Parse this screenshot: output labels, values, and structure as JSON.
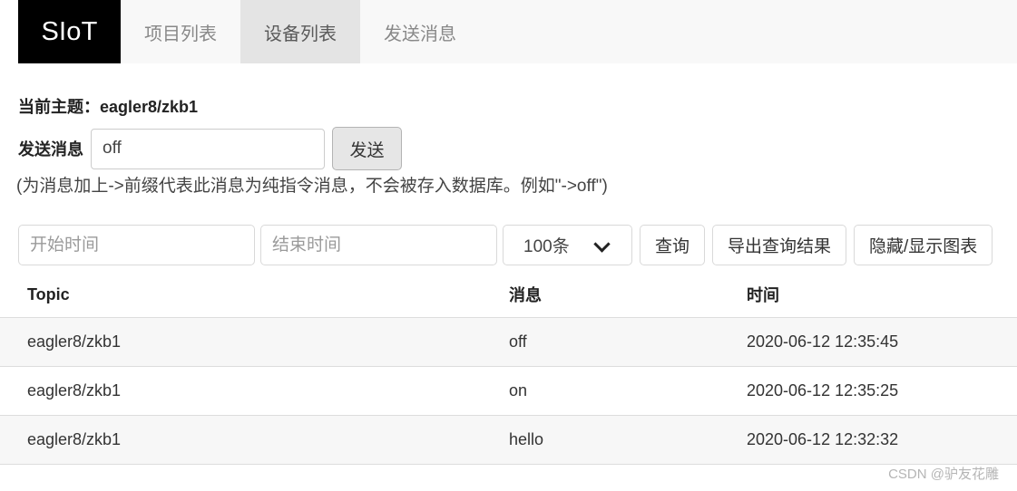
{
  "navbar": {
    "brand": "SIoT",
    "items": [
      {
        "label": "项目列表",
        "active": false
      },
      {
        "label": "设备列表",
        "active": true
      },
      {
        "label": "发送消息",
        "active": false
      }
    ]
  },
  "topic": {
    "label": "当前主题：eagler8/zkb1"
  },
  "send": {
    "label": "发送消息",
    "input_value": "off",
    "input_placeholder": "",
    "button_label": "发送"
  },
  "hint": {
    "text": "(为消息加上->前缀代表此消息为纯指令消息，不会被存入数据库。例如\"->off\")"
  },
  "filters": {
    "start_time_placeholder": "开始时间",
    "start_time_value": "",
    "end_time_placeholder": "结束时间",
    "end_time_value": "",
    "count_select_value": "100条",
    "count_select_icon": "chevron-down-icon",
    "query_button": "查询",
    "export_button": "导出查询结果",
    "toggle_chart_button": "隐藏/显示图表"
  },
  "table": {
    "columns": [
      "Topic",
      "消息",
      "时间"
    ],
    "rows": [
      {
        "topic": "eagler8/zkb1",
        "message": "off",
        "time": "2020-06-12 12:35:45"
      },
      {
        "topic": "eagler8/zkb1",
        "message": "on",
        "time": "2020-06-12 12:35:25"
      },
      {
        "topic": "eagler8/zkb1",
        "message": "hello",
        "time": "2020-06-12 12:32:32"
      }
    ]
  },
  "watermark": {
    "text": "CSDN @驴友花雕"
  }
}
